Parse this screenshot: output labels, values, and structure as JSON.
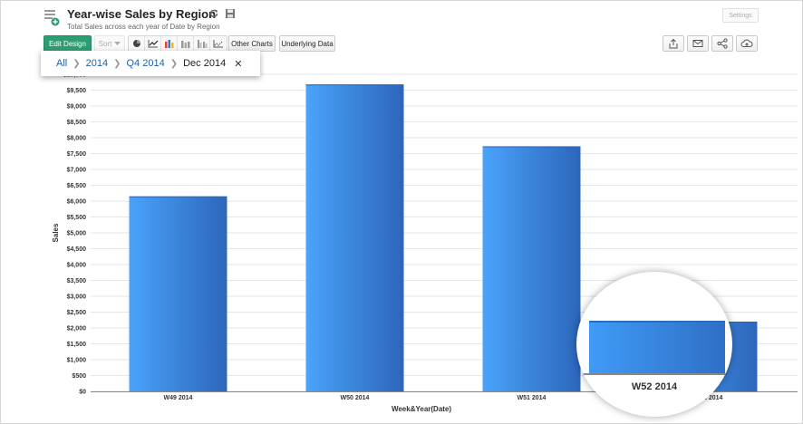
{
  "header": {
    "title": "Year-wise Sales by Region",
    "subtitle": "Total Sales across each year of Date by Region",
    "settings_label": "Settings"
  },
  "toolbar": {
    "edit_design_label": "Edit Design",
    "sort_label": "Sort",
    "other_charts_label": "Other Charts",
    "underlying_data_label": "Underlying Data",
    "chart_type_icons": [
      "pie-chart-icon",
      "line-chart-icon",
      "bar-chart-icon",
      "stacked-bar-icon",
      "grouped-bar-icon",
      "scatter-chart-icon"
    ],
    "action_icons": [
      "export-icon",
      "email-icon",
      "share-icon",
      "publish-icon"
    ]
  },
  "breadcrumb": {
    "items": [
      "All",
      "2014",
      "Q4 2014"
    ],
    "current": "Dec 2014"
  },
  "magnifier": {
    "label": "W52 2014"
  },
  "colors": {
    "bar_light": "#4aa3fb",
    "bar_dark": "#2c66bb",
    "primary_button": "#2e9e72",
    "link": "#1f5f9e"
  },
  "chart_data": {
    "type": "bar",
    "categories": [
      "W49 2014",
      "W50 2014",
      "W51 2014",
      "W52 2014"
    ],
    "values": [
      6150,
      9680,
      7730,
      2200
    ],
    "xlabel": "Week&Year(Date)",
    "ylabel": "Sales",
    "ylim": [
      0,
      10000
    ],
    "yticks": [
      "$0",
      "$500",
      "$1,000",
      "$1,500",
      "$2,000",
      "$2,500",
      "$3,000",
      "$3,500",
      "$4,000",
      "$4,500",
      "$5,000",
      "$5,500",
      "$6,000",
      "$6,500",
      "$7,000",
      "$7,500",
      "$8,000",
      "$8,500",
      "$9,000",
      "$9,500",
      "$10,000"
    ],
    "grid": true,
    "legend": "none"
  }
}
